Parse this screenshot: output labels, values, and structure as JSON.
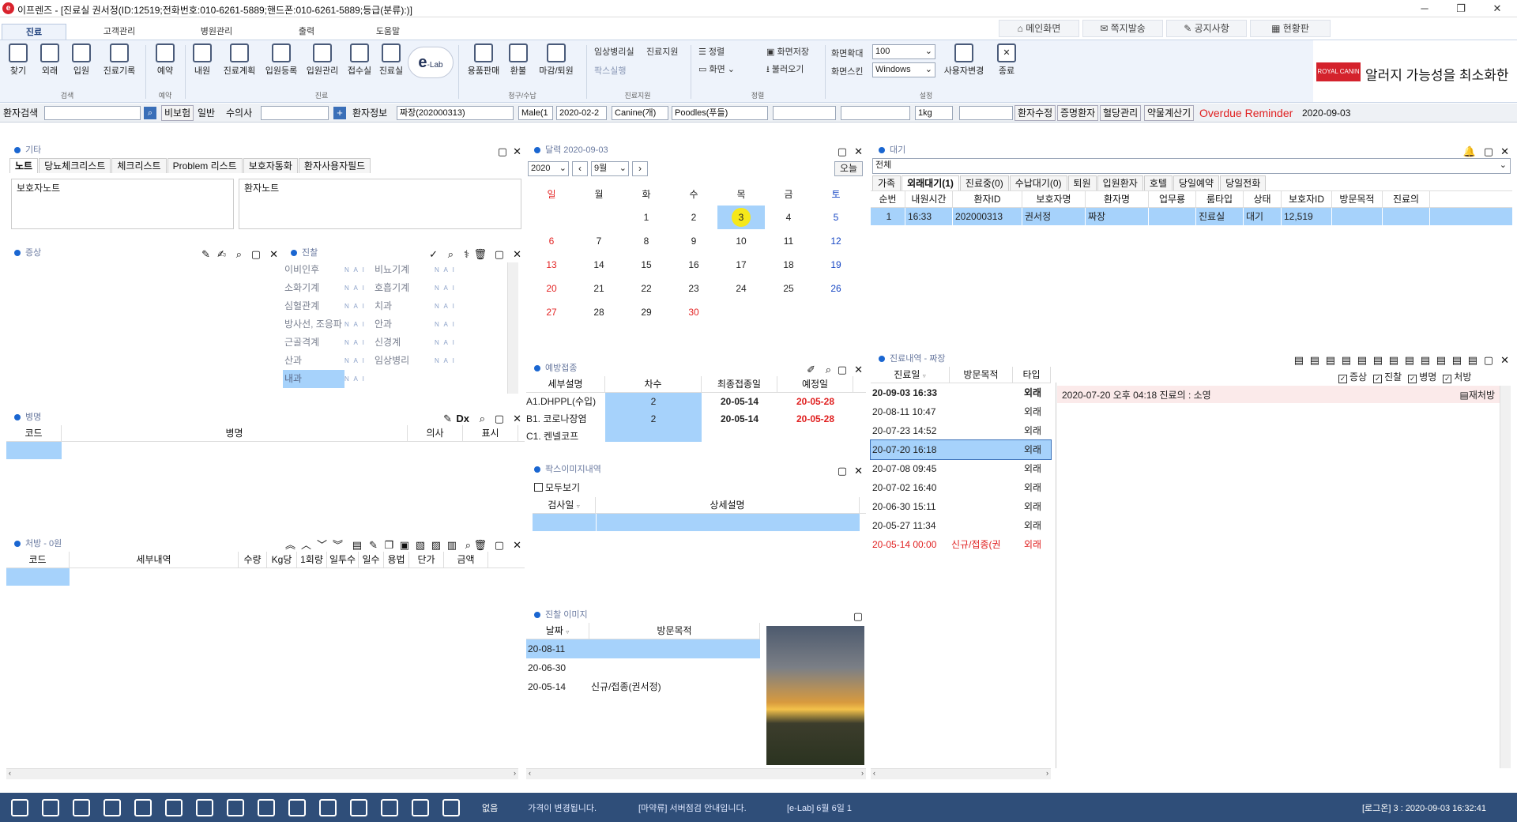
{
  "window": {
    "title": "이프렌즈 - [진료실 권서정(ID:12519;전화번호:010-6261-5889;핸드폰:010-6261-5889;등급(분류):)]",
    "logo": "e",
    "minimize": "─",
    "restore": "❐",
    "close": "✕"
  },
  "menu_tabs": [
    "진료",
    "고객관리",
    "병원관리",
    "출력",
    "도움말"
  ],
  "quick": {
    "main": "메인화면",
    "message": "쪽지발송",
    "notice": "공지사항",
    "status": "현황판"
  },
  "ribbon": {
    "buttons": [
      "찾기",
      "외래",
      "입원",
      "진료기록",
      "예약",
      "내원",
      "진료계획",
      "입원등록",
      "입원관리",
      "접수실",
      "진료실",
      "용품판매",
      "환불",
      "마감/퇴원"
    ],
    "elab": "e",
    "elab_sub": "-Lab",
    "groups": [
      "검색",
      "예약",
      "진료",
      "청구/수납",
      "진료지원",
      "정렬",
      "설정"
    ],
    "support": {
      "lab": "임상병리실",
      "support": "진료지원",
      "pax": "팍스실행"
    },
    "sort": "정렬",
    "view": "화면",
    "save_screen": "화면저장",
    "load": "불러오기",
    "zoom_label": "화면확대",
    "zoom": "100",
    "skin_label": "화면스킨",
    "skin": "Windows",
    "user_change": "사용자변경",
    "exit": "종료"
  },
  "banner": {
    "brand": "ROYAL CANIN",
    "text": "알러지 가능성을 최소화한"
  },
  "patient_bar": {
    "search_label": "환자검색",
    "search_value": "",
    "insurance": "비보험",
    "normal": "일반",
    "vet_label": "수의사",
    "vet_value": "",
    "info_label": "환자정보",
    "info": "짜장(202000313)",
    "sex": "Male(1",
    "birth": "2020-02-2",
    "species": "Canine(개)",
    "breed": "Poodles(푸들)",
    "weight": "1kg",
    "edit": "환자수정",
    "cert": "증명환자",
    "blood": "혈당관리",
    "drug": "약물계산기",
    "overdue": "Overdue Reminder",
    "date": "2020-09-03"
  },
  "etc": {
    "title": "기타",
    "tabs": [
      "노트",
      "당뇨체크리스트",
      "체크리스트",
      "Problem 리스트",
      "보호자통화",
      "환자사용자필드"
    ],
    "guardian_note": "보호자노트",
    "patient_note": "환자노트"
  },
  "symptom": {
    "title": "증상"
  },
  "exam": {
    "title": "진찰",
    "items": [
      [
        "이비인후",
        "비뇨기계"
      ],
      [
        "소화기계",
        "호흡기계"
      ],
      [
        "심혈관계",
        "치과"
      ],
      [
        "방사선, 조응파",
        "안과"
      ],
      [
        "근골격계",
        "신경계"
      ],
      [
        "산과",
        "임상병리"
      ],
      [
        "내과",
        ""
      ]
    ],
    "nai": "N A I"
  },
  "disease": {
    "title": "병명",
    "cols": [
      "코드",
      "병명",
      "의사",
      "표시"
    ]
  },
  "rx": {
    "title": "처방 - 0원",
    "cols": [
      "코드",
      "세부내역",
      "수량",
      "Kg당",
      "1회량",
      "일투수",
      "일수",
      "용법",
      "단가",
      "금액"
    ]
  },
  "calendar": {
    "title": "달력 2020-09-03",
    "year": "2020",
    "month": "9월",
    "today_btn": "오늘",
    "days": [
      "일",
      "월",
      "화",
      "수",
      "목",
      "금",
      "토"
    ],
    "weeks": [
      [
        "",
        "",
        "1",
        "2",
        "3",
        "4",
        "5"
      ],
      [
        "6",
        "7",
        "8",
        "9",
        "10",
        "11",
        "12"
      ],
      [
        "13",
        "14",
        "15",
        "16",
        "17",
        "18",
        "19"
      ],
      [
        "20",
        "21",
        "22",
        "23",
        "24",
        "25",
        "26"
      ],
      [
        "27",
        "28",
        "29",
        "30",
        "",
        "",
        ""
      ]
    ],
    "today": "3"
  },
  "vaccine": {
    "title": "예방접종",
    "cols": [
      "세부설명",
      "차수",
      "최종접종일",
      "예정일"
    ],
    "rows": [
      [
        "A1.DHPPL(수입)",
        "2",
        "20-05-14",
        "20-05-28"
      ],
      [
        "B1. 코로나장염",
        "2",
        "20-05-14",
        "20-05-28"
      ],
      [
        "C1. 켄넬코프",
        "",
        "",
        ""
      ]
    ]
  },
  "pax": {
    "title": "팍스이미지내역",
    "show_all": "모두보기",
    "cols": [
      "검사일",
      "상세설명"
    ]
  },
  "photo": {
    "title": "진찰 이미지",
    "cols": [
      "날짜",
      "방문목적"
    ],
    "rows": [
      [
        "20-08-11",
        ""
      ],
      [
        "20-06-30",
        ""
      ],
      [
        "20-05-14",
        "신규/접종(권서정)"
      ]
    ]
  },
  "waiting": {
    "title": "대기",
    "filter": "전체",
    "tabs": [
      "가족",
      "외래대기(1)",
      "진료중(0)",
      "수납대기(0)",
      "퇴원",
      "입원환자",
      "호텔",
      "당일예약",
      "당일전화"
    ],
    "cols": [
      "순번",
      "내원시간",
      "환자ID",
      "보호자명",
      "환자명",
      "업무룡",
      "룸타입",
      "상태",
      "보호자ID",
      "방문목적",
      "진료의"
    ],
    "rows": [
      [
        "1",
        "16:33",
        "202000313",
        "권서정",
        "짜장",
        "",
        "진료실",
        "대기",
        "12,519",
        "",
        ""
      ]
    ]
  },
  "history": {
    "title": "진료내역 - 짜장",
    "cols": [
      "진료일",
      "방문목적",
      "타입"
    ],
    "checks": [
      "증상",
      "진찰",
      "병명",
      "처방"
    ],
    "rows": [
      [
        "20-09-03 16:33",
        "",
        "외래"
      ],
      [
        "20-08-11 10:47",
        "",
        "외래"
      ],
      [
        "20-07-23 14:52",
        "",
        "외래"
      ],
      [
        "20-07-20 16:18",
        "",
        "외래"
      ],
      [
        "20-07-08 09:45",
        "",
        "외래"
      ],
      [
        "20-07-02 16:40",
        "",
        "외래"
      ],
      [
        "20-06-30 15:11",
        "",
        "외래"
      ],
      [
        "20-05-27 11:34",
        "",
        "외래"
      ],
      [
        "20-05-14 00:00",
        "신규/접종(권",
        "외래"
      ]
    ],
    "detail": "2020-07-20 오후 04:18 진료의 : 소영",
    "reissue": "재처방"
  },
  "status": {
    "none": "없음",
    "msg1": "가격이 변경됩니다.",
    "msg2": "[마약류] 서버점검 안내입니다.",
    "msg3": "[e-Lab] 6월 6일 1",
    "login": "[로그온] 3 : 2020-09-03 16:32:41"
  }
}
